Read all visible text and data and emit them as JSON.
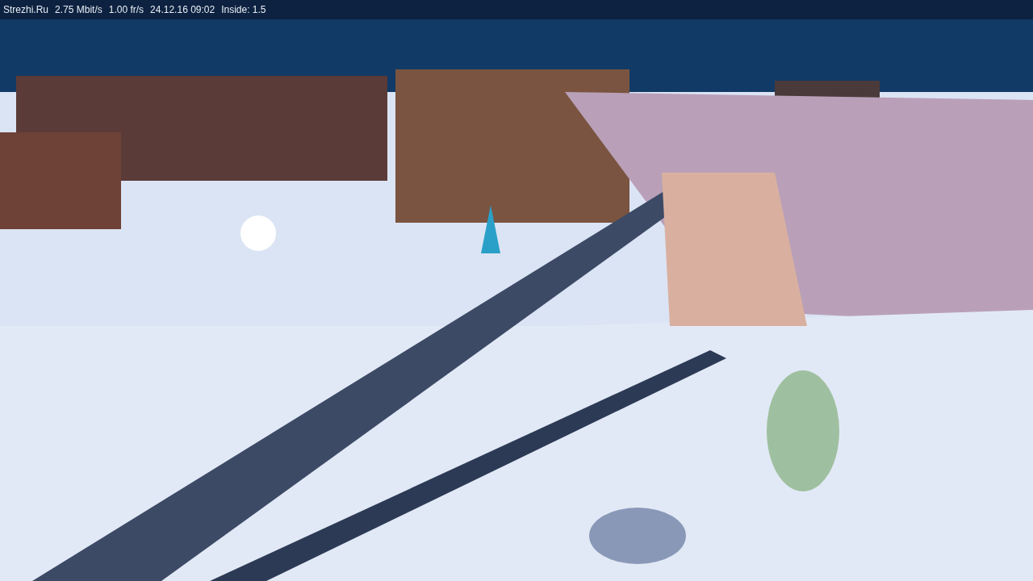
{
  "status_bar": {
    "items": [
      "Strezhi.Ru",
      "2.75 Mbit/s",
      "1.00 fr/s",
      "24.12.16 09:02",
      "Inside: 1.5"
    ]
  }
}
